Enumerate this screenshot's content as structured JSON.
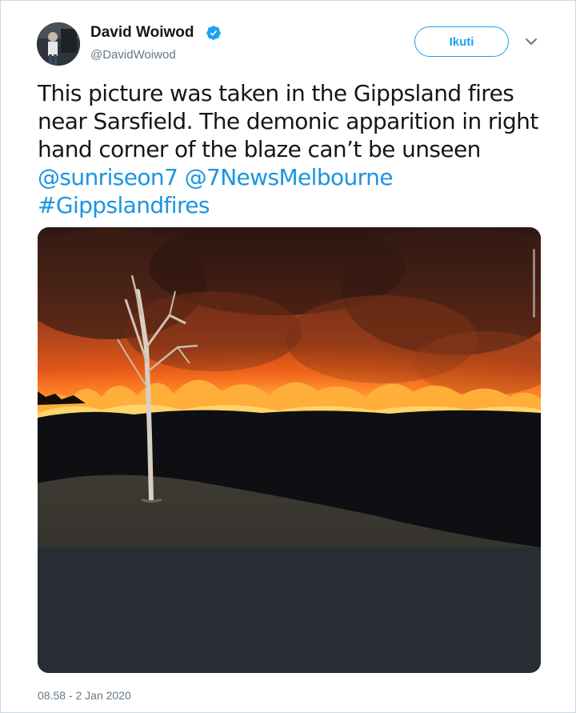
{
  "author": {
    "name": "David Woiwod",
    "handle": "@DavidWoiwod",
    "verified": true,
    "avatar_icon": "profile-photo"
  },
  "follow_label": "Ikuti",
  "tweet": {
    "text_main": "This picture was taken in the Gippsland fires near Sarsfield. The demonic apparition in right hand corner of the blaze can’t be unseen ",
    "mention_1": "@sunriseon7",
    "mention_2": "@7NewsMelbourne",
    "hashtag": "#Gippslandfires"
  },
  "timestamp": "08.58 - 2 Jan 2020",
  "colors": {
    "accent": "#1da1f2",
    "link": "#1b95e0",
    "text": "#14171a",
    "muted": "#657786"
  }
}
